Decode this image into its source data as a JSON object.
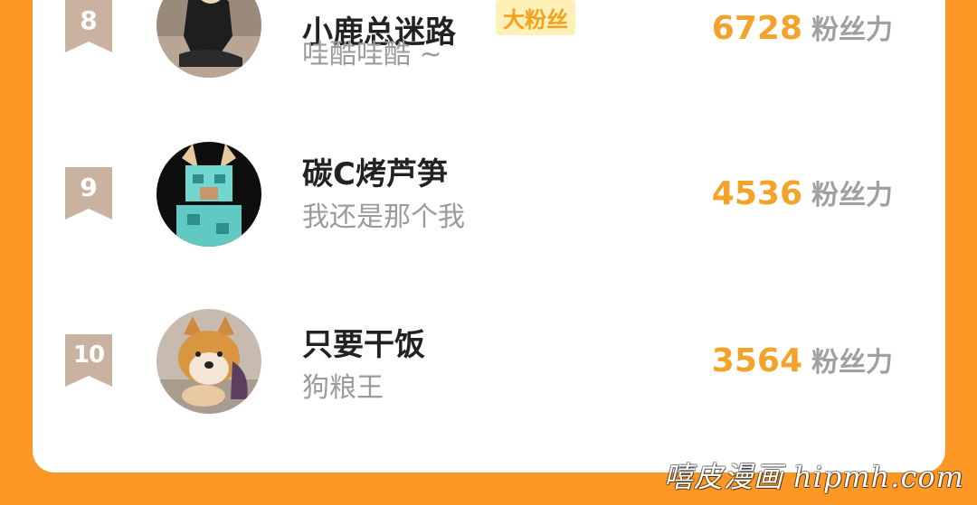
{
  "colors": {
    "outer_background": "#FD9827",
    "card_background": "#FFFFFF",
    "rank_badge": "#C9B3A0",
    "score_value": "#F3A32A",
    "score_unit": "#A0A0A0",
    "name_text": "#222222",
    "subtitle_text": "#9B9B9B",
    "fan_tag_bg": "#FFF0B8",
    "fan_tag_text": "#F5A01C"
  },
  "leaderboard": {
    "rows": [
      {
        "rank": "8",
        "name": "小鹿总迷路",
        "tag": "大粉丝",
        "subtitle": "哇酷哇酷 ~",
        "score": "6728",
        "score_unit": "粉丝力",
        "avatar_icon": "avatar-photo-person"
      },
      {
        "rank": "9",
        "name": "碳C烤芦笋",
        "subtitle": "我还是那个我",
        "score": "4536",
        "score_unit": "粉丝力",
        "avatar_icon": "avatar-minecraft-fox"
      },
      {
        "rank": "10",
        "name": "只要干饭",
        "subtitle": "狗粮王",
        "score": "3564",
        "score_unit": "粉丝力",
        "avatar_icon": "avatar-shiba-dog"
      }
    ]
  },
  "watermark": "嘻皮漫画 hipmh.com"
}
